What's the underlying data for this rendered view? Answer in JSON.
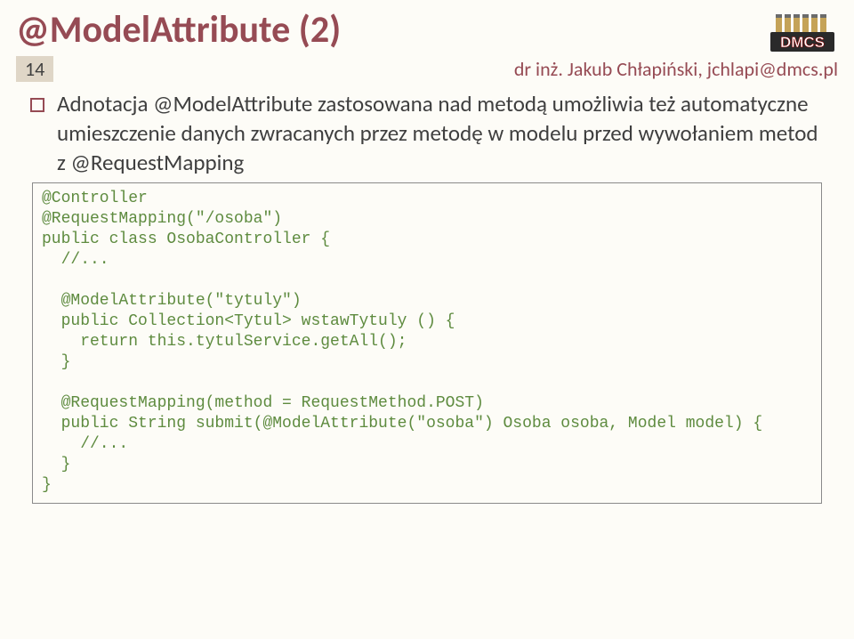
{
  "title": "@ModelAttribute (2)",
  "page_number": "14",
  "author": "dr inż. Jakub Chłapiński, jchlapi@dmcs.pl",
  "logo_text_top": "DMCS",
  "bullet": "Adnotacja @ModelAttribute zastosowana nad metodą umożliwia też automatyczne umieszczenie danych zwracanych przez metodę w modelu przed wywołaniem metod z @RequestMapping",
  "code": "@Controller\n@RequestMapping(\"/osoba\")\npublic class OsobaController {\n  //...\n\n  @ModelAttribute(\"tytuly\")\n  public Collection<Tytul> wstawTytuly () {\n    return this.tytulService.getAll();\n  }\n\n  @RequestMapping(method = RequestMethod.POST)\n  public String submit(@ModelAttribute(\"osoba\") Osoba osoba, Model model) {\n    //...\n  }\n}"
}
